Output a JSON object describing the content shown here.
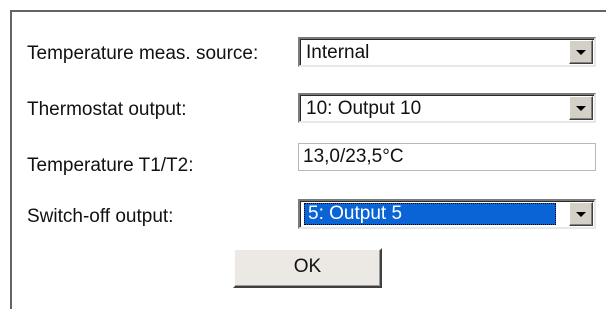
{
  "form": {
    "source_label": "Temperature meas. source:",
    "source_value": "Internal",
    "thermostat_label": "Thermostat output:",
    "thermostat_value": "10: Output  10",
    "temperature_label": "Temperature T1/T2:",
    "temperature_value": "13,0/23,5°C",
    "switchoff_label": "Switch-off output:",
    "switchoff_value": "5: Output  5"
  },
  "buttons": {
    "ok_label": "OK"
  },
  "colors": {
    "selection": "#0a64d6",
    "button_face": "#ece9e4"
  }
}
